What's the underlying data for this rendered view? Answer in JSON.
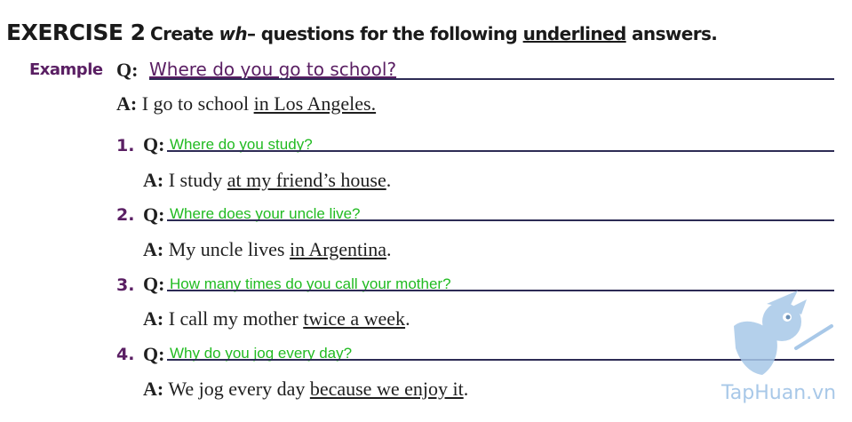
{
  "header": {
    "exercise": "EXERCISE 2",
    "instruction_part1": "Create ",
    "instruction_italic": "wh",
    "instruction_part2": "– questions for the following ",
    "instruction_underlined": "underlined",
    "instruction_part3": " answers."
  },
  "example": {
    "tag": "Example",
    "q_label": "Q:",
    "question": "Where do you go to school?",
    "a_label": "A:",
    "answer_before": "I go to school ",
    "answer_underlined": "in Los Angeles."
  },
  "items": [
    {
      "number": "1.",
      "q_label": "Q:",
      "question": "Where do you study?",
      "a_label": "A:",
      "answer_before": "I study ",
      "answer_underlined": "at my friend’s house",
      "answer_after": "."
    },
    {
      "number": "2.",
      "q_label": "Q:",
      "question": "Where does your uncle live?",
      "a_label": "A:",
      "answer_before": "My uncle lives ",
      "answer_underlined": "in Argentina",
      "answer_after": "."
    },
    {
      "number": "3.",
      "q_label": "Q:",
      "question": "How many times do you call your mother?",
      "a_label": "A:",
      "answer_before": "I call my mother ",
      "answer_underlined": "twice a week",
      "answer_after": "."
    },
    {
      "number": "4.",
      "q_label": "Q:",
      "question": "Why do you jog every day?",
      "a_label": "A:",
      "answer_before": "We jog every day ",
      "answer_underlined": "because we enjoy it",
      "answer_after": "."
    }
  ],
  "watermark": {
    "text": "TapHuan.vn",
    "icon": "bird-mascot-icon"
  },
  "colors": {
    "purple": "#5a1f63",
    "green": "#22bb22",
    "line": "#2d2b55",
    "watermark": "#a8c8e8"
  }
}
